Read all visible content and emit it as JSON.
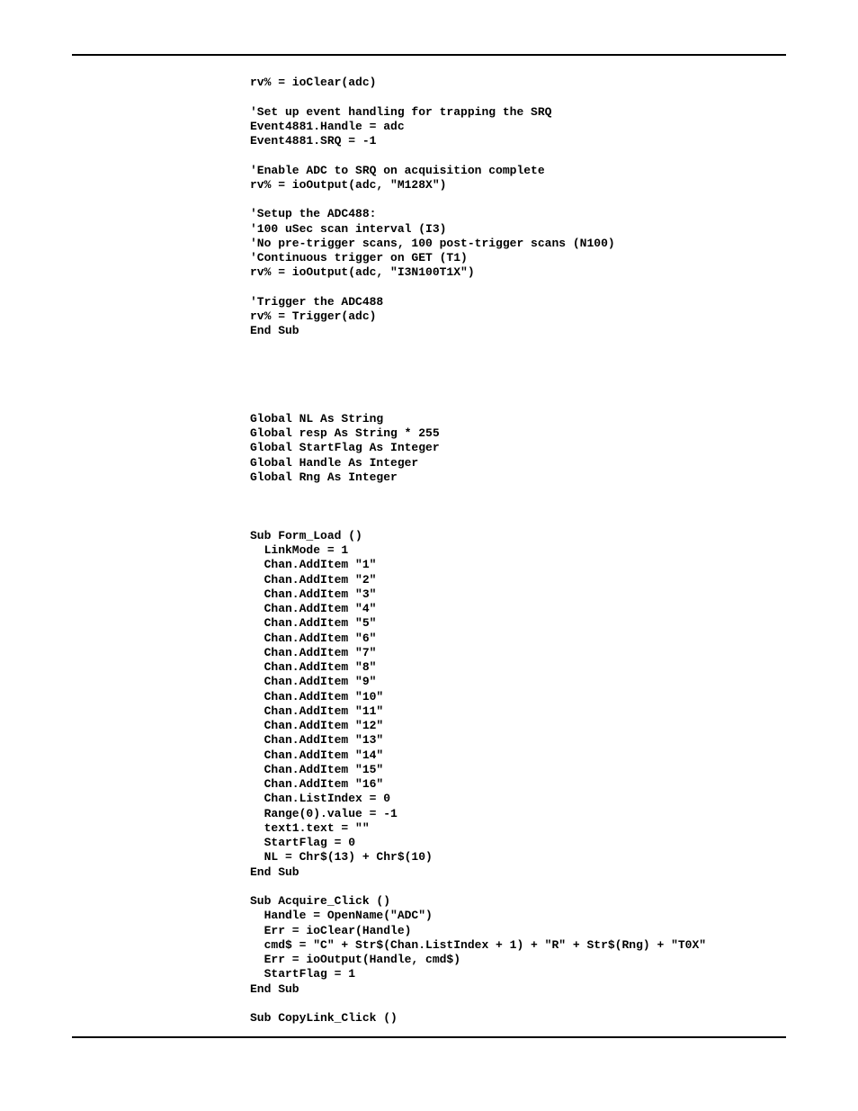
{
  "code_lines": [
    "rv% = ioClear(adc)",
    "",
    "'Set up event handling for trapping the SRQ",
    "Event4881.Handle = adc",
    "Event4881.SRQ = -1",
    "",
    "'Enable ADC to SRQ on acquisition complete",
    "rv% = ioOutput(adc, \"M128X\")",
    "",
    "'Setup the ADC488:",
    "'100 uSec scan interval (I3)",
    "'No pre-trigger scans, 100 post-trigger scans (N100)",
    "'Continuous trigger on GET (T1)",
    "rv% = ioOutput(adc, \"I3N100T1X\")",
    "",
    "'Trigger the ADC488",
    "rv% = Trigger(adc)",
    "End Sub",
    "",
    "",
    "",
    "",
    "",
    "Global NL As String",
    "Global resp As String * 255",
    "Global StartFlag As Integer",
    "Global Handle As Integer",
    "Global Rng As Integer",
    "",
    "",
    "",
    "Sub Form_Load ()",
    "  LinkMode = 1",
    "  Chan.AddItem \"1\"",
    "  Chan.AddItem \"2\"",
    "  Chan.AddItem \"3\"",
    "  Chan.AddItem \"4\"",
    "  Chan.AddItem \"5\"",
    "  Chan.AddItem \"6\"",
    "  Chan.AddItem \"7\"",
    "  Chan.AddItem \"8\"",
    "  Chan.AddItem \"9\"",
    "  Chan.AddItem \"10\"",
    "  Chan.AddItem \"11\"",
    "  Chan.AddItem \"12\"",
    "  Chan.AddItem \"13\"",
    "  Chan.AddItem \"14\"",
    "  Chan.AddItem \"15\"",
    "  Chan.AddItem \"16\"",
    "  Chan.ListIndex = 0",
    "  Range(0).value = -1",
    "  text1.text = \"\"",
    "  StartFlag = 0",
    "  NL = Chr$(13) + Chr$(10)",
    "End Sub",
    "",
    "Sub Acquire_Click ()",
    "  Handle = OpenName(\"ADC\")",
    "  Err = ioClear(Handle)",
    "  cmd$ = \"C\" + Str$(Chan.ListIndex + 1) + \"R\" + Str$(Rng) + \"T0X\"",
    "  Err = ioOutput(Handle, cmd$)",
    "  StartFlag = 1",
    "End Sub",
    "",
    "Sub CopyLink_Click ()"
  ]
}
